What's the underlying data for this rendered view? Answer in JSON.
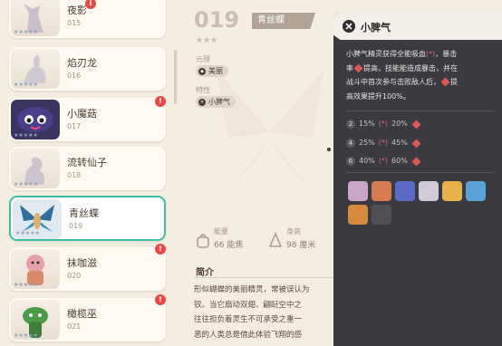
{
  "list": {
    "items": [
      {
        "name": "夜影",
        "number": "015",
        "alert": "i",
        "color": "#c9c2cf"
      },
      {
        "name": "焰刃龙",
        "number": "016",
        "alert": "",
        "color": "#d3ccd4"
      },
      {
        "name": "小魔菇",
        "number": "017",
        "alert": "!",
        "color": "#3d3a6a"
      },
      {
        "name": "流转仙子",
        "number": "018",
        "alert": "",
        "color": "#cfc8d0"
      },
      {
        "name": "青丝蝶",
        "number": "019",
        "alert": "",
        "color": "#3a8fb8",
        "selected": true
      },
      {
        "name": "抹咖滋",
        "number": "020",
        "alert": "!",
        "color": "#e6a0a8"
      },
      {
        "name": "橄榄巫",
        "number": "021",
        "alert": "!",
        "color": "#4c9a46"
      }
    ],
    "stars": "★★★★★"
  },
  "detail": {
    "number": "019",
    "name": "青丝蝶",
    "stars": "★★★",
    "element_label": "元理",
    "element_value": "美丽",
    "trait_label": "特性",
    "trait_value": "小脾气",
    "energy_label": "能量",
    "energy_value": "66 能焦",
    "height_label": "身高",
    "height_value": "98 厘米",
    "intro_title": "简介",
    "intro_lines": [
      "形似蝴蝶的美丽精灵，常被误认为",
      "钗。当它扇动双翅、翩跹空中之",
      "往往担负着灵生不可承受之重一",
      "恶的人类总是借此体验飞翔的感"
    ]
  },
  "tooltip": {
    "title": "小脾气",
    "desc_1": "小脾气精灵获得全能吸血",
    "desc_1b": "(*)",
    "desc_1c": "，暴击",
    "desc_2": "率",
    "desc_2b": "提高，技能能造成暴击，并在",
    "desc_3": "战斗中首次参与击败敌人后，",
    "desc_3b": "提",
    "desc_4": "高效果提升100%。",
    "levels": [
      {
        "n": "2",
        "a": "15%",
        "ah": "(*)",
        "b": "20%"
      },
      {
        "n": "4",
        "a": "25%",
        "ah": "(*)",
        "b": "45%"
      },
      {
        "n": "6",
        "a": "40%",
        "ah": "(*)",
        "b": "60%"
      }
    ],
    "avatar_colors": [
      "#c9a5c7",
      "#d67b52",
      "#5b6ac4",
      "#cfc9d8",
      "#e8b24a",
      "#5aa3d8",
      "#d58a3e",
      "#4f4f55"
    ]
  },
  "colors": {
    "accent": "#3cc0a8",
    "alert": "#e84848",
    "panel_bg": "#3a3a40"
  }
}
